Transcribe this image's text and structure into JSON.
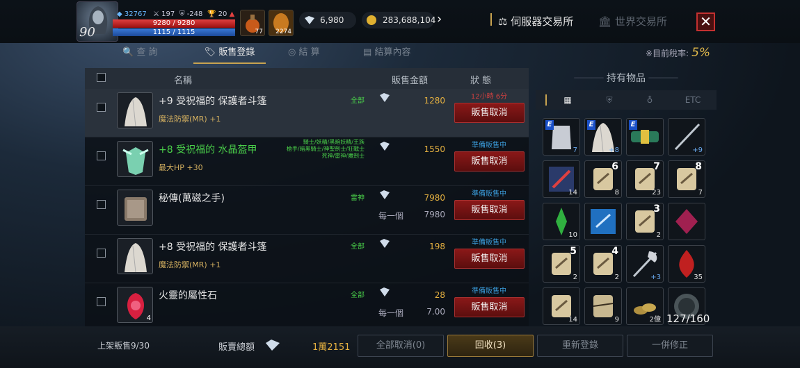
{
  "player": {
    "level": "90",
    "power": "32767",
    "stat2": "197",
    "stat3": "-248",
    "stat4": "20",
    "hp": "9280 / 9280",
    "mp": "1115 / 1115"
  },
  "quick_slots": [
    {
      "icon": "potion-icon",
      "count": "77"
    },
    {
      "icon": "scroll-icon",
      "count": "2274"
    }
  ],
  "currency": {
    "diamonds": "6,980",
    "gold": "283,688,104"
  },
  "exchange": {
    "server": "伺服器交易所",
    "world": "世界交易所"
  },
  "tabs": [
    "查 詢",
    "販售登錄",
    "結 算",
    "結算內容"
  ],
  "tax": {
    "label": "※目前稅率:",
    "value": "5%"
  },
  "table": {
    "col_name": "名稱",
    "col_price": "販售金額",
    "col_state": "狀 態"
  },
  "rows": [
    {
      "name": "+9 受祝福的 保護者斗篷",
      "green": false,
      "sub": "魔法防禦(MR) +1",
      "job": "全部",
      "price": "1280",
      "per_label": "",
      "per_price": "",
      "state": "12小時 6分",
      "timer": true,
      "cancel": "販售取消",
      "icon": "cloak-icon",
      "qty": ""
    },
    {
      "name": "+8 受祝福的 水晶盔甲",
      "green": true,
      "sub": "最大HP +30",
      "job": "騎士/妖精/黑暗妖精/王族\n槍手/暗黑騎士/神聖劍士/狂戰士\n死神/雷神/魔劍士",
      "price": "1550",
      "per_label": "",
      "per_price": "",
      "state": "準備販售中",
      "timer": false,
      "cancel": "販售取消",
      "icon": "crystal-armor-icon",
      "qty": ""
    },
    {
      "name": "秘傳(萬磁之手)",
      "green": false,
      "sub": "",
      "job": "雷神",
      "price": "7980",
      "per_label": "每一個",
      "per_price": "7980",
      "state": "準備販售中",
      "timer": false,
      "cancel": "販售取消",
      "icon": "book-icon",
      "qty": ""
    },
    {
      "name": "+8 受祝福的 保護者斗篷",
      "green": false,
      "sub": "魔法防禦(MR) +1",
      "job": "全部",
      "price": "198",
      "per_label": "",
      "per_price": "",
      "state": "準備販售中",
      "timer": false,
      "cancel": "販售取消",
      "icon": "cloak-icon",
      "qty": ""
    },
    {
      "name": "火靈的屬性石",
      "green": false,
      "sub": "",
      "job": "全部",
      "price": "28",
      "per_label": "每一個",
      "per_price": "7.00",
      "state": "準備販售中",
      "timer": false,
      "cancel": "販售取消",
      "icon": "fire-stone-icon",
      "qty": "4"
    }
  ],
  "inventory": {
    "title": "持有物品",
    "tabs": [
      "grid-icon",
      "shield-icon",
      "ring-icon",
      "ETC"
    ],
    "items": [
      {
        "icon": "armor-icon",
        "qty": "7",
        "enchant": "",
        "E": true,
        "blueq": true
      },
      {
        "icon": "cloak-icon",
        "qty": "+8",
        "enchant": "",
        "E": true,
        "blueq": true
      },
      {
        "icon": "belt-icon",
        "qty": "",
        "enchant": "",
        "E": true,
        "blueq": false
      },
      {
        "icon": "staff-icon",
        "qty": "+9",
        "enchant": "",
        "E": false,
        "blueq": true
      },
      {
        "icon": "rune-icon",
        "qty": "14",
        "enchant": "",
        "E": false,
        "blueq": false
      },
      {
        "icon": "scroll-icon",
        "qty": "8",
        "enchant": "6",
        "E": false,
        "blueq": false
      },
      {
        "icon": "scroll-icon",
        "qty": "23",
        "enchant": "7",
        "E": false,
        "blueq": false
      },
      {
        "icon": "scroll-icon",
        "qty": "7",
        "enchant": "8",
        "E": false,
        "blueq": false
      },
      {
        "icon": "green-crystal-icon",
        "qty": "10",
        "enchant": "",
        "E": false,
        "blueq": false
      },
      {
        "icon": "blue-scroll-icon",
        "qty": "",
        "enchant": "",
        "E": false,
        "blueq": false
      },
      {
        "icon": "scroll-icon",
        "qty": "2",
        "enchant": "3",
        "E": false,
        "blueq": false
      },
      {
        "icon": "red-crystal-icon",
        "qty": "",
        "enchant": "",
        "E": false,
        "blueq": false
      },
      {
        "icon": "scroll-icon",
        "qty": "2",
        "enchant": "5",
        "E": false,
        "blueq": false
      },
      {
        "icon": "scroll-icon",
        "qty": "2",
        "enchant": "4",
        "E": false,
        "blueq": false
      },
      {
        "icon": "axe-icon",
        "qty": "+3",
        "enchant": "",
        "E": false,
        "blueq": true
      },
      {
        "icon": "fire-icon",
        "qty": "35",
        "enchant": "",
        "E": false,
        "blueq": false
      },
      {
        "icon": "scroll-icon",
        "qty": "14",
        "enchant": "",
        "E": false,
        "blueq": false
      },
      {
        "icon": "torn-scroll-icon",
        "qty": "9",
        "enchant": "",
        "E": false,
        "blueq": false
      },
      {
        "icon": "coins-icon",
        "qty": "2億",
        "enchant": "",
        "E": false,
        "blueq": false
      },
      {
        "icon": "coin-icon",
        "qty": "",
        "enchant": "",
        "E": false,
        "blueq": false
      }
    ],
    "capacity": "127/160"
  },
  "footer": {
    "listed": "上架販售9/30",
    "total_label": "販賣總額",
    "total": "1萬2151",
    "cancel_all": "全部取消(0)",
    "reclaim": "回收(3)",
    "relist": "重新登錄",
    "edit": "一併修正"
  },
  "colors": {
    "accent": "#c9a450",
    "cancel": "#8a1818",
    "state": "#3a9ad8",
    "price": "#e4b040"
  }
}
